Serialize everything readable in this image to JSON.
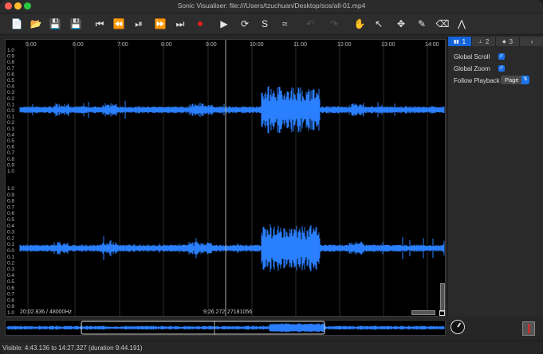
{
  "window": {
    "title": "Sonic Visualiser: file:///Users/tzuchuan/Desktop/sos/all-01.mp4"
  },
  "toolbar": {
    "buttons": [
      {
        "name": "new-session-icon",
        "glyph": "📄"
      },
      {
        "name": "open-icon",
        "glyph": "📂"
      },
      {
        "name": "save-icon",
        "glyph": "💾"
      },
      {
        "name": "save-as-icon",
        "glyph": "💾"
      },
      {
        "name": "rewind-start-icon",
        "glyph": "⏮"
      },
      {
        "name": "rewind-icon",
        "glyph": "⏪"
      },
      {
        "name": "play-pause-icon",
        "glyph": "⏯"
      },
      {
        "name": "fast-forward-icon",
        "glyph": "⏩"
      },
      {
        "name": "forward-end-icon",
        "glyph": "⏭"
      },
      {
        "name": "record-icon",
        "glyph": "⏺"
      },
      {
        "name": "play-selection-icon",
        "glyph": "▶"
      },
      {
        "name": "loop-icon",
        "glyph": "⟳"
      },
      {
        "name": "solo-icon",
        "glyph": "S"
      },
      {
        "name": "speedup-icon",
        "glyph": "≈"
      },
      {
        "name": "undo-icon",
        "glyph": "↶"
      },
      {
        "name": "redo-icon",
        "glyph": "↷"
      },
      {
        "name": "navigate-icon",
        "glyph": "✋"
      },
      {
        "name": "select-icon",
        "glyph": "↖"
      },
      {
        "name": "move-icon",
        "glyph": "✥"
      },
      {
        "name": "draw-icon",
        "glyph": "✎"
      },
      {
        "name": "erase-icon",
        "glyph": "⌫"
      },
      {
        "name": "measure-icon",
        "glyph": "⋀"
      }
    ]
  },
  "timeline": {
    "ticks": [
      "5:00",
      "6:00",
      "7:00",
      "8:00",
      "9:00",
      "10:00",
      "11:00",
      "12:00",
      "13:00",
      "14:00"
    ]
  },
  "scale": {
    "top": [
      "1.0",
      "0.9",
      "0.8",
      "0.7",
      "0.6",
      "0.5",
      "0.4",
      "0.3",
      "0.2",
      "0.1",
      "0.0",
      "0.1",
      "0.2",
      "0.3",
      "0.4",
      "0.5",
      "0.6",
      "0.7",
      "0.8",
      "0.9",
      "1.0"
    ],
    "bottom": [
      "1.0",
      "0.9",
      "0.8",
      "0.7",
      "0.6",
      "0.5",
      "0.4",
      "0.3",
      "0.2",
      "0.1",
      "0.0",
      "0.1",
      "0.2",
      "0.3",
      "0.4",
      "0.5",
      "0.6",
      "0.7",
      "0.8",
      "0.9",
      "1.0"
    ]
  },
  "pane": {
    "start_label": "20:02.836 / 48000Hz",
    "cursor_label": "9:26.272",
    "frame_label": "27181056"
  },
  "property_box": {
    "tabs": [
      "1",
      "2",
      "3"
    ],
    "global_scroll": "Global Scroll",
    "global_zoom": "Global Zoom",
    "follow_playback": "Follow Playback",
    "follow_value": "Page"
  },
  "status": {
    "text": "Visible: 4:43.136 to 14:27.327 (duration 9:44.191)"
  },
  "colors": {
    "waveform": "#2a7fff",
    "accent": "#1a73e8",
    "record": "#e02020"
  }
}
